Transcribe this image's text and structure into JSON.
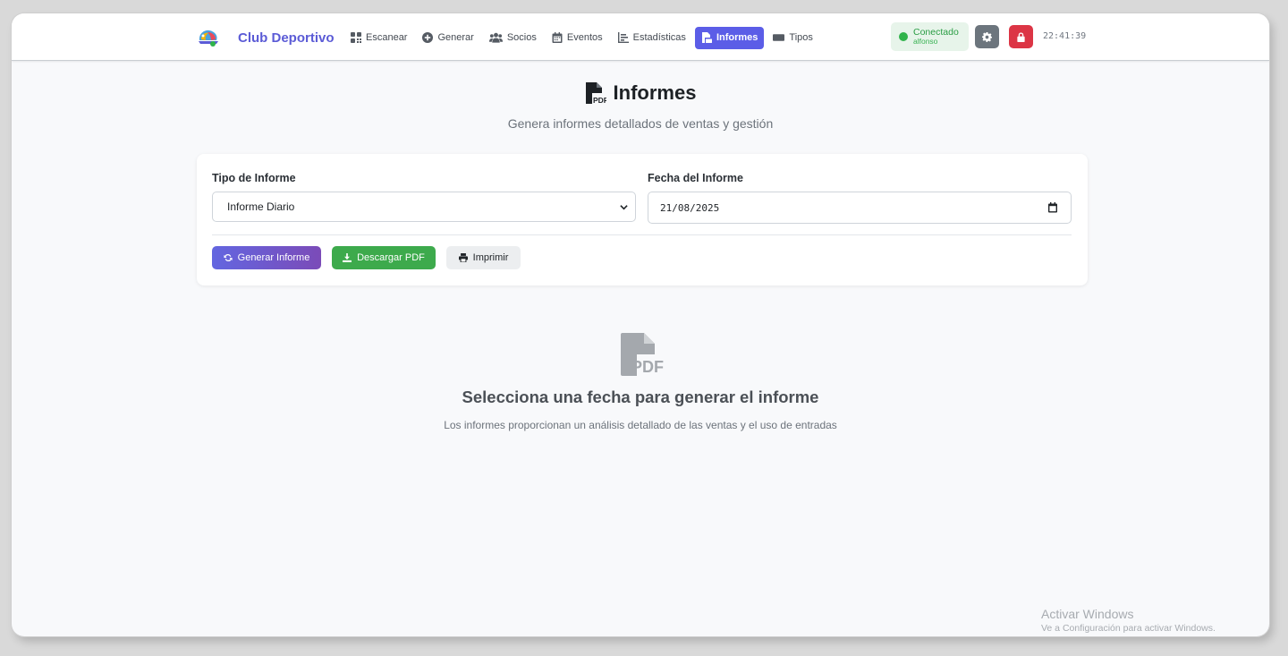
{
  "brand": {
    "name": "Club Deportivo",
    "logo_icon": "colorful-logo-icon"
  },
  "nav": [
    {
      "label": "Escanear",
      "icon": "grid-icon",
      "active": false
    },
    {
      "label": "Generar",
      "icon": "plus-circle-icon",
      "active": false
    },
    {
      "label": "Socios",
      "icon": "users-icon",
      "active": false
    },
    {
      "label": "Eventos",
      "icon": "calendar-icon",
      "active": false
    },
    {
      "label": "Estadísticas",
      "icon": "chart-icon",
      "active": false
    },
    {
      "label": "Informes",
      "icon": "file-pdf-icon",
      "active": true
    },
    {
      "label": "Tipos",
      "icon": "ticket-icon",
      "active": false
    }
  ],
  "status": {
    "label": "Conectado",
    "user": "alfonso"
  },
  "clock": "22:41:39",
  "page": {
    "title": "Informes",
    "subtitle": "Genera informes detallados de ventas y gestión"
  },
  "form": {
    "type_label": "Tipo de Informe",
    "type_value": "Informe Diario",
    "date_label": "Fecha del Informe",
    "date_value": "21/08/2025"
  },
  "buttons": {
    "generar": "Generar Informe",
    "descargar": "Descargar PDF",
    "imprimir": "Imprimir"
  },
  "empty": {
    "title": "Selecciona una fecha para generar el informe",
    "description": "Los informes proporcionan un análisis detallado de las ventas y el uso de entradas"
  },
  "watermark": {
    "title": "Activar Windows",
    "subtitle": "Ve a Configuración para activar Windows."
  },
  "colors": {
    "accent": "#5b5de7",
    "success": "#3daa4c",
    "danger": "#dc3545",
    "secondary": "#6c757d"
  }
}
